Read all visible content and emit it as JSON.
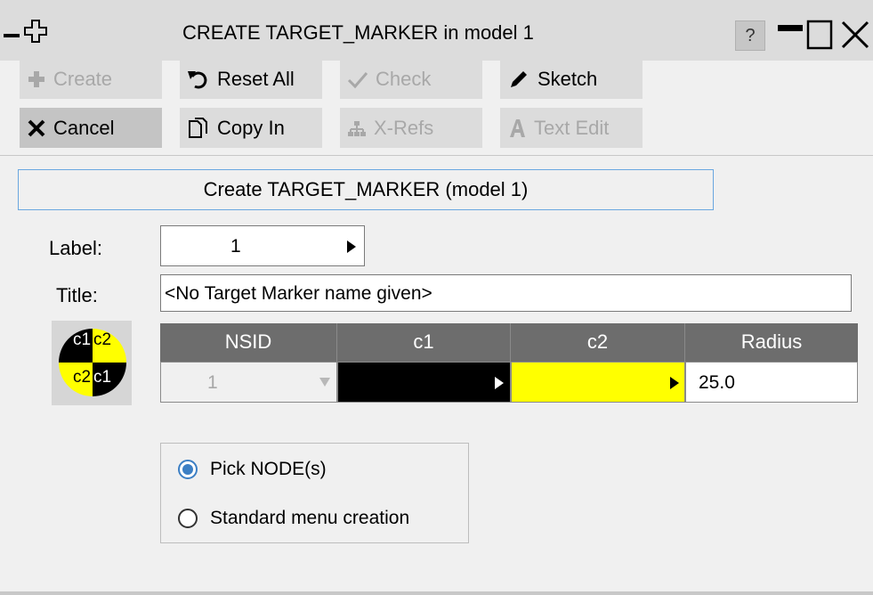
{
  "window": {
    "title": "CREATE TARGET_MARKER in model 1",
    "help_label": "?",
    "icons": [
      "minimize-dash-icon",
      "pin-cross-icon",
      "restore-icon",
      "maximize-icon",
      "close-icon"
    ]
  },
  "toolbar": {
    "create": "Create",
    "reset_all": "Reset All",
    "check": "Check",
    "sketch": "Sketch",
    "cancel": "Cancel",
    "copy_in": "Copy In",
    "xrefs": "X-Refs",
    "text_edit": "Text Edit"
  },
  "panel": {
    "header": "Create TARGET_MARKER (model 1)",
    "label_caption": "Label:",
    "label_value": "1",
    "title_caption": "Title:",
    "title_value": "<No Target Marker name given>"
  },
  "marker_icon": {
    "c1": "c1",
    "c2": "c2"
  },
  "table": {
    "headers": [
      "NSID",
      "c1",
      "c2",
      "Radius"
    ],
    "row": {
      "nsid": "1",
      "c1_color": "#000000",
      "c2_color": "#ffff00",
      "radius": "25.0"
    }
  },
  "options": {
    "pick_nodes": "Pick NODE(s)",
    "standard_menu": "Standard menu creation",
    "selected": "pick_nodes"
  },
  "colors": {
    "accent": "#3c7fc4",
    "header_bg": "#6d6d6d",
    "yellow": "#ffff00"
  }
}
